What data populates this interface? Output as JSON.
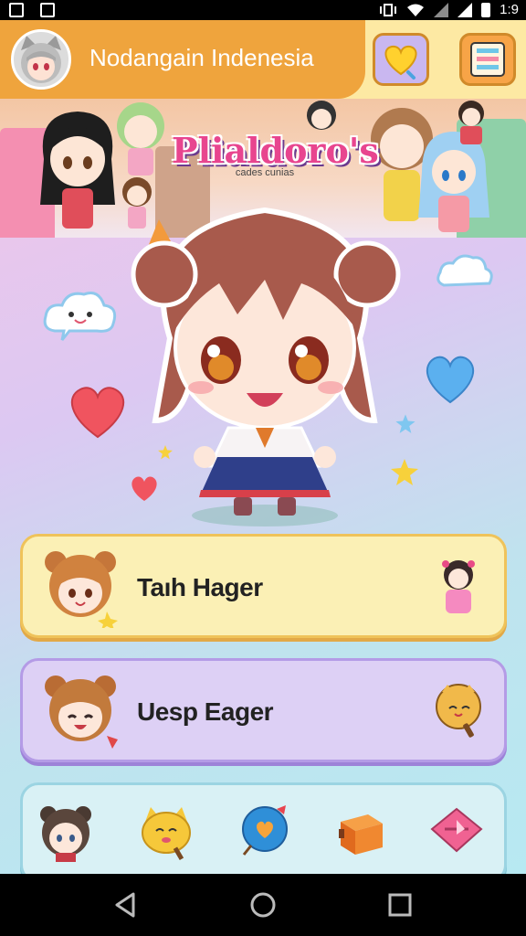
{
  "status_bar": {
    "time": "1:9",
    "icons": [
      "notification-icon",
      "sim-card-icon",
      "vibrate-icon",
      "wifi-icon",
      "signal-icon",
      "battery-icon"
    ]
  },
  "header": {
    "title": "Nodangain Indenesia",
    "favorite_icon": "heart-icon",
    "menu_icon": "menu-icon"
  },
  "banner": {
    "logo": "Plialdoro's",
    "logo_sub": "cades cunias"
  },
  "cards": [
    {
      "label": "Taıh Hager",
      "icon": "chibi-girl-icon"
    },
    {
      "label": "Uesp Eager",
      "icon": "cookie-character-icon"
    }
  ],
  "tray": {
    "icons": [
      "bear-avatar-icon",
      "cat-icon",
      "balloon-icon",
      "gift-box-icon",
      "pink-gift-icon"
    ]
  },
  "nav": {
    "icons": [
      "back-icon",
      "home-icon",
      "recents-icon"
    ]
  },
  "colors": {
    "header_orange": "#efa43d",
    "card_yellow": "#fbf0b5",
    "card_purple": "#ddd0f5",
    "card_teal": "#d9f1f5"
  }
}
